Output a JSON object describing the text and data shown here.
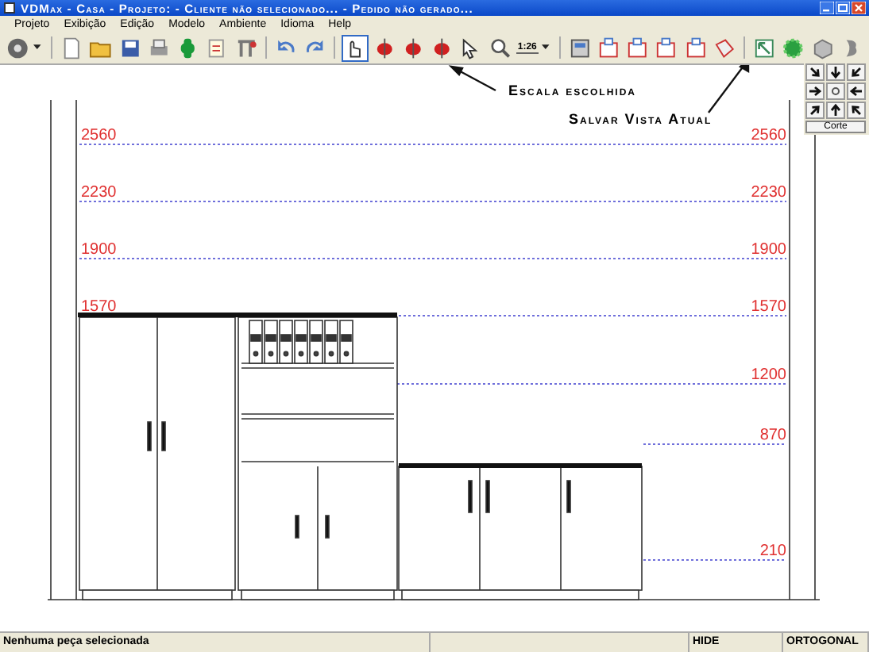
{
  "window": {
    "title": "VDMax - Casa - Projeto:  - Cliente não selecionado... - Pedido não gerado..."
  },
  "menu": [
    "Projeto",
    "Exibição",
    "Edição",
    "Modelo",
    "Ambiente",
    "Idioma",
    "Help"
  ],
  "toolbar": {
    "scale": "1:26"
  },
  "annotations": [
    {
      "text": "Escala escolhida"
    },
    {
      "text": "Salvar Vista Atual"
    }
  ],
  "view_pad": {
    "button": "Corte"
  },
  "levels": [
    {
      "left_label": "2560",
      "right_label": "2560"
    },
    {
      "left_label": "2230",
      "right_label": "2230"
    },
    {
      "left_label": "1900",
      "right_label": "1900"
    },
    {
      "left_label": "1570",
      "right_label": "1570"
    },
    {
      "right_label": "1200"
    },
    {
      "right_label": "870"
    },
    {
      "right_label": "210"
    }
  ],
  "status_bar": {
    "message": "Nenhuma peça selecionada",
    "mode": "HIDE",
    "projection": "ORTOGONAL"
  }
}
